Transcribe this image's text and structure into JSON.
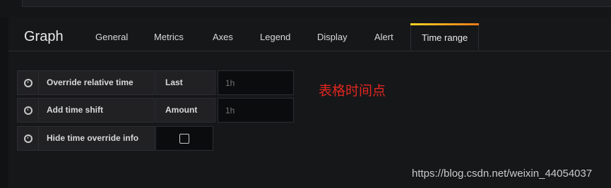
{
  "header": {
    "title": "Graph"
  },
  "tabs": [
    {
      "label": "General",
      "active": false
    },
    {
      "label": "Metrics",
      "active": false
    },
    {
      "label": "Axes",
      "active": false
    },
    {
      "label": "Legend",
      "active": false
    },
    {
      "label": "Display",
      "active": false
    },
    {
      "label": "Alert",
      "active": false
    },
    {
      "label": "Time range",
      "active": true
    }
  ],
  "time_range": {
    "override_relative": {
      "icon": "clock-icon",
      "label": "Override relative time",
      "sub_label": "Last",
      "placeholder": "1h"
    },
    "time_shift": {
      "icon": "clock-icon",
      "label": "Add time shift",
      "sub_label": "Amount",
      "placeholder": "1h"
    },
    "hide_info": {
      "icon": "clock-icon",
      "label": "Hide time override info",
      "checked": false
    }
  },
  "annotation": "表格时间点",
  "watermark": "https://blog.csdn.net/weixin_44054037",
  "colors": {
    "accent_gradient_start": "#f9d423",
    "accent_gradient_end": "#eb7b18",
    "annotation": "#e0271f"
  }
}
